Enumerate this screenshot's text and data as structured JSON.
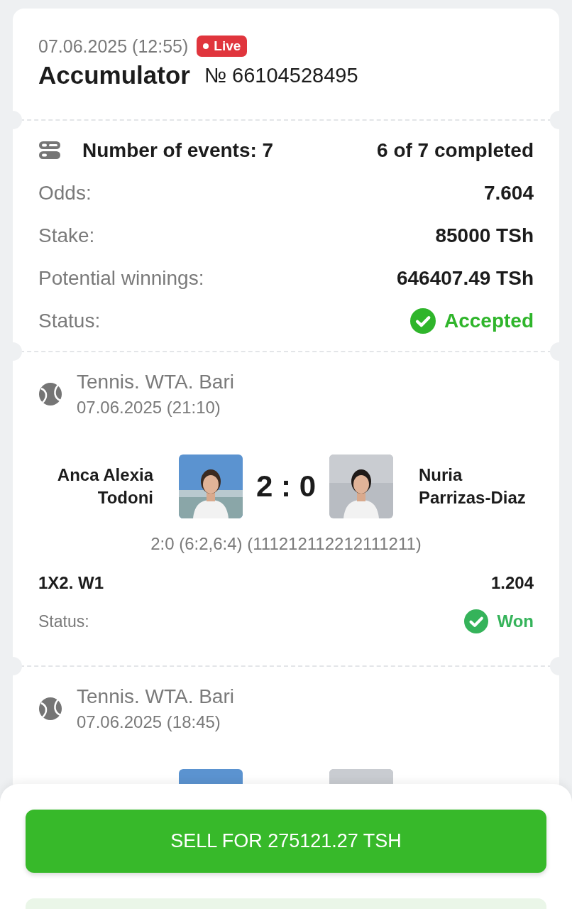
{
  "bet": {
    "datetime": "07.06.2025 (12:55)",
    "live_badge": "Live",
    "title": "Accumulator",
    "number": "№ 66104528495"
  },
  "summary": {
    "events_label": "Number of events: 7",
    "completed": "6 of 7 completed",
    "rows": [
      {
        "label": "Odds:",
        "value": "7.604"
      },
      {
        "label": "Stake:",
        "value": "85000 TSh"
      },
      {
        "label": "Potential winnings:",
        "value": "646407.49 TSh"
      }
    ],
    "status": {
      "label": "Status:",
      "value": "Accepted",
      "kind": "accepted"
    }
  },
  "events": [
    {
      "league": "Tennis. WTA. Bari",
      "datetime": "07.06.2025 (21:10)",
      "player_1": "Anca Alexia Todoni",
      "player_2": "Nuria Parrizas-Diaz",
      "score": "2 : 0",
      "details": "2:0 (6:2,6:4) (111212112212111211)",
      "market": "1X2. W1",
      "odds": "1.204",
      "status": {
        "label": "Status:",
        "value": "Won",
        "kind": "won"
      }
    },
    {
      "league": "Tennis. WTA. Bari",
      "datetime": "07.06.2025 (18:45)"
    }
  ],
  "sell_button": "SELL FOR 275121.27 TSH"
}
